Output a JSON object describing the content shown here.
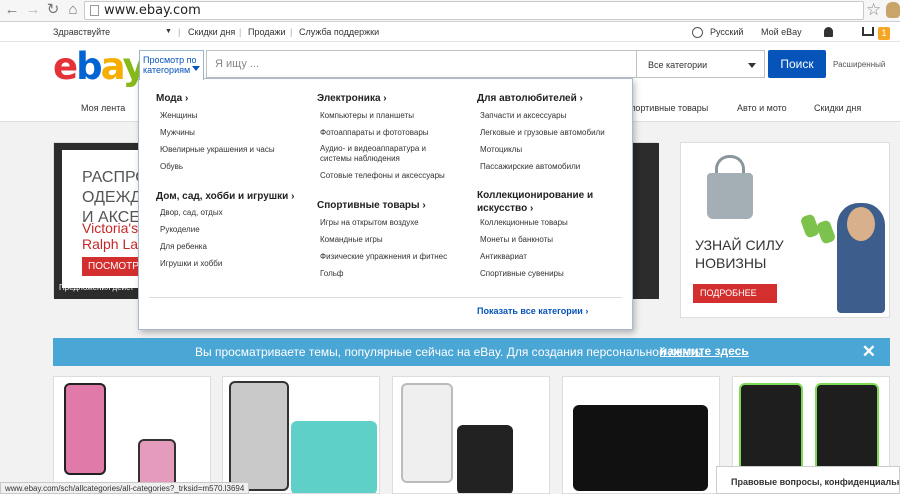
{
  "browser": {
    "url": "www.ebay.com",
    "status_url": "www.ebay.com/sch/allcategories/all-categories?_trksid=m570.l3694"
  },
  "util_bar": {
    "greeting": "Здравствуйте",
    "daily_deals": "Скидки дня",
    "selling": "Продажи",
    "help": "Служба поддержки",
    "language": "Русский",
    "my_ebay": "Мой eBay",
    "cart_count": "1"
  },
  "header": {
    "logo": [
      "e",
      "b",
      "a",
      "y"
    ],
    "browse_label": "Просмотр по категориям",
    "search_placeholder": "Я ищу ...",
    "category_select": "Все категории",
    "search_button": "Поиск",
    "advanced": "Расширенный"
  },
  "tabs": [
    {
      "label": "Моя лента"
    },
    {
      "label": "Спортивные товары"
    },
    {
      "label": "Авто и мото"
    },
    {
      "label": "Скидки дня"
    }
  ],
  "mega_menu": {
    "columns": [
      {
        "groups": [
          {
            "title": "Мода",
            "items": [
              "Женщины",
              "Мужчины",
              "Ювелирные украшения и часы",
              "Обувь"
            ]
          },
          {
            "title": "Дом, сад, хобби и игрушки",
            "items": [
              "Двор, сад, отдых",
              "Рукоделие",
              "Для ребенка",
              "Игрушки и хобби"
            ]
          }
        ]
      },
      {
        "groups": [
          {
            "title": "Электроника",
            "items": [
              "Компьютеры и планшеты",
              "Фотоаппараты и фототовары",
              "Аудио- и видеоаппаратура и системы наблюдения",
              "Сотовые телефоны и аксессуары"
            ]
          },
          {
            "title": "Спортивные товары",
            "items": [
              "Игры на открытом воздухе",
              "Командные игры",
              "Физические упражнения и фитнес",
              "Гольф"
            ]
          }
        ]
      },
      {
        "groups": [
          {
            "title": "Для автолюбителей",
            "items": [
              "Запчасти и аксессуары",
              "Легковые и грузовые автомобили",
              "Мотоциклы",
              "Пассажирские автомобили"
            ]
          },
          {
            "title": "Коллекционирование и искусство",
            "items": [
              "Коллекционные товары",
              "Монеты и банкноты",
              "Антиквариат",
              "Спортивные сувениры"
            ]
          }
        ]
      }
    ],
    "show_all": "Показать все категории"
  },
  "hero": {
    "headline": "РАСПРОД\nОДЕЖДА\nИ АКСЕС",
    "brands": "Victoria's Se\nRalph Lauren",
    "button": "ПОСМОТРЕ",
    "caption": "Предложения дейст"
  },
  "promo": {
    "line1": "УЗНАЙ СИЛУ",
    "line2": "НОВИЗНЫ",
    "button": "ПОДРОБНЕЕ"
  },
  "feed_strip": {
    "text": "Вы просматриваете темы, популярные сейчас на eBay. Для создания персональной ленты",
    "link": "нажмите здесь"
  },
  "privacy_tab": "Правовые вопросы, конфиденциальность",
  "colors": {
    "brand_blue": "#0654ba",
    "strip": "#4aa6d4",
    "promo_red": "#d32f2f"
  }
}
